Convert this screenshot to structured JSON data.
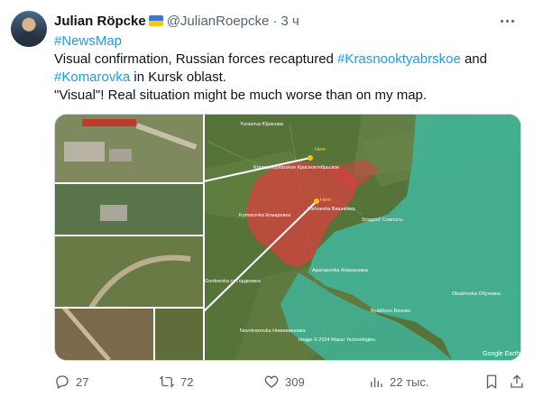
{
  "author": {
    "name": "Julian Röpcke",
    "handle": "@JulianRoepcke",
    "separator": "·",
    "time": "3 ч"
  },
  "tweet": {
    "hashtag1": "#NewsMap",
    "line2_a": "Visual confirmation, Russian forces recaptured ",
    "hashtag2": "#Krasnooktyabrskoe",
    "line2_b": " and",
    "hashtag3": "#Komarovka",
    "line3": " in Kursk oblast.",
    "line4": "\"Visual\"! Real situation might be much worse than on my map."
  },
  "map": {
    "labels": {
      "yurasova": "Yurasova Юрасова",
      "here1": "Here",
      "krasno": "Krasnooktyabrskoe Красноктябрьское",
      "here2": "Here",
      "vishnevka": "Vishnevka Вишнёвка",
      "komarovka": "Komarovka Комаровка",
      "snagost": "Snagost' Снагость",
      "apanasovka": "Apanasovka Апанасовка",
      "obukhovka": "Obukhovka Обуховка",
      "gordeevka": "Gordeevka ст Гордеевка",
      "byakhovo": "Byakhovo Бяхово",
      "novoivanovka": "Novoivanovka Новоивановка",
      "copyright": "Image © 2024 Maxar Technologies",
      "google": "Google Earth"
    },
    "colors": {
      "occupied": "#d9403f",
      "ukraine": "#3fb79c"
    }
  },
  "actions": {
    "replies": "27",
    "retweets": "72",
    "likes": "309",
    "views": "22 тыс."
  }
}
